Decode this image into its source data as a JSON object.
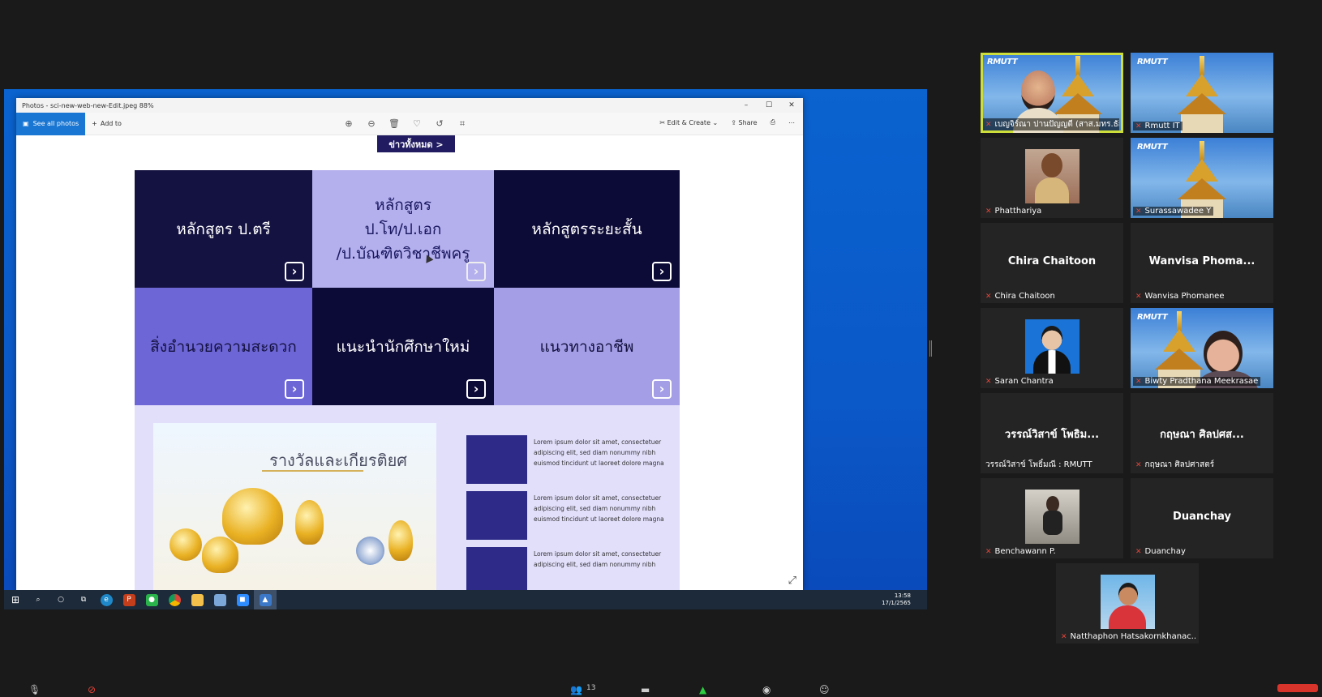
{
  "photos": {
    "title": "Photos - sci-new-web-new-Edit.jpeg  88%",
    "see_all": "See all photos",
    "add_to": "Add to",
    "edit_create": "Edit & Create",
    "share": "Share"
  },
  "web": {
    "all_news": "ข่าวทั้งหมด >",
    "tiles": [
      {
        "label": "หลักสูตร ป.ตรี"
      },
      {
        "label": "หลักสูตร\nป.โท/ป.เอก\n/ป.บัณฑิตวิชาชีพครู"
      },
      {
        "label": "หลักสูตรระยะสั้น"
      },
      {
        "label": "สิ่งอำนวยความสะดวก"
      },
      {
        "label": "แนะนำนักศึกษาใหม่"
      },
      {
        "label": "แนวทางอาชีพ"
      }
    ],
    "award_title": "รางวัลและเกียรติยศ",
    "lorem": "Lorem ipsum dolor sit amet, consectetuer adipiscing elit, sed diam nonummy nibh euismod tincidunt ut laoreet dolore magna",
    "lorem_cut": "Lorem ipsum dolor sit amet, consectetuer adipiscing elit, sed diam nonummy nibh"
  },
  "taskbar": {
    "time": "13:58",
    "date": "17/1/2565"
  },
  "participants": [
    {
      "name": "เบญจิร์ณา ปานปัญญดี (สาส.มทร.ธัญ...",
      "type": "video-temple",
      "highlight": true
    },
    {
      "name": "Rmutt IT",
      "type": "video-temple"
    },
    {
      "name": "Phatthariya",
      "type": "photo"
    },
    {
      "name": "Surassawadee Y",
      "type": "video-temple"
    },
    {
      "name": "Chira Chaitoon",
      "display": "Chira Chaitoon",
      "type": "name"
    },
    {
      "name": "Wanvisa Phomanee",
      "display": "Wanvisa  Phoma...",
      "type": "name"
    },
    {
      "name": "Saran Chantra",
      "type": "photo"
    },
    {
      "name": "Biwty Pradthana Meekrasae",
      "type": "video-temple"
    },
    {
      "name": "วรรณ์วิสาข์ โพธิ์มณี : RMUTT",
      "display": "วรรณ์วิสาข์ โพธิม...",
      "type": "name"
    },
    {
      "name": "กฤษณา  ศิลปศาสตร์",
      "display": "กฤษณา  ศิลปศส...",
      "type": "name"
    },
    {
      "name": "Benchawann P.",
      "type": "photo"
    },
    {
      "name": "Duanchay",
      "display": "Duanchay",
      "type": "name"
    },
    {
      "name": "Natthaphon Hatsakornkhanac...",
      "type": "photo"
    }
  ],
  "controls": {
    "participants_count": "13"
  },
  "logo_text": "RMUTT"
}
